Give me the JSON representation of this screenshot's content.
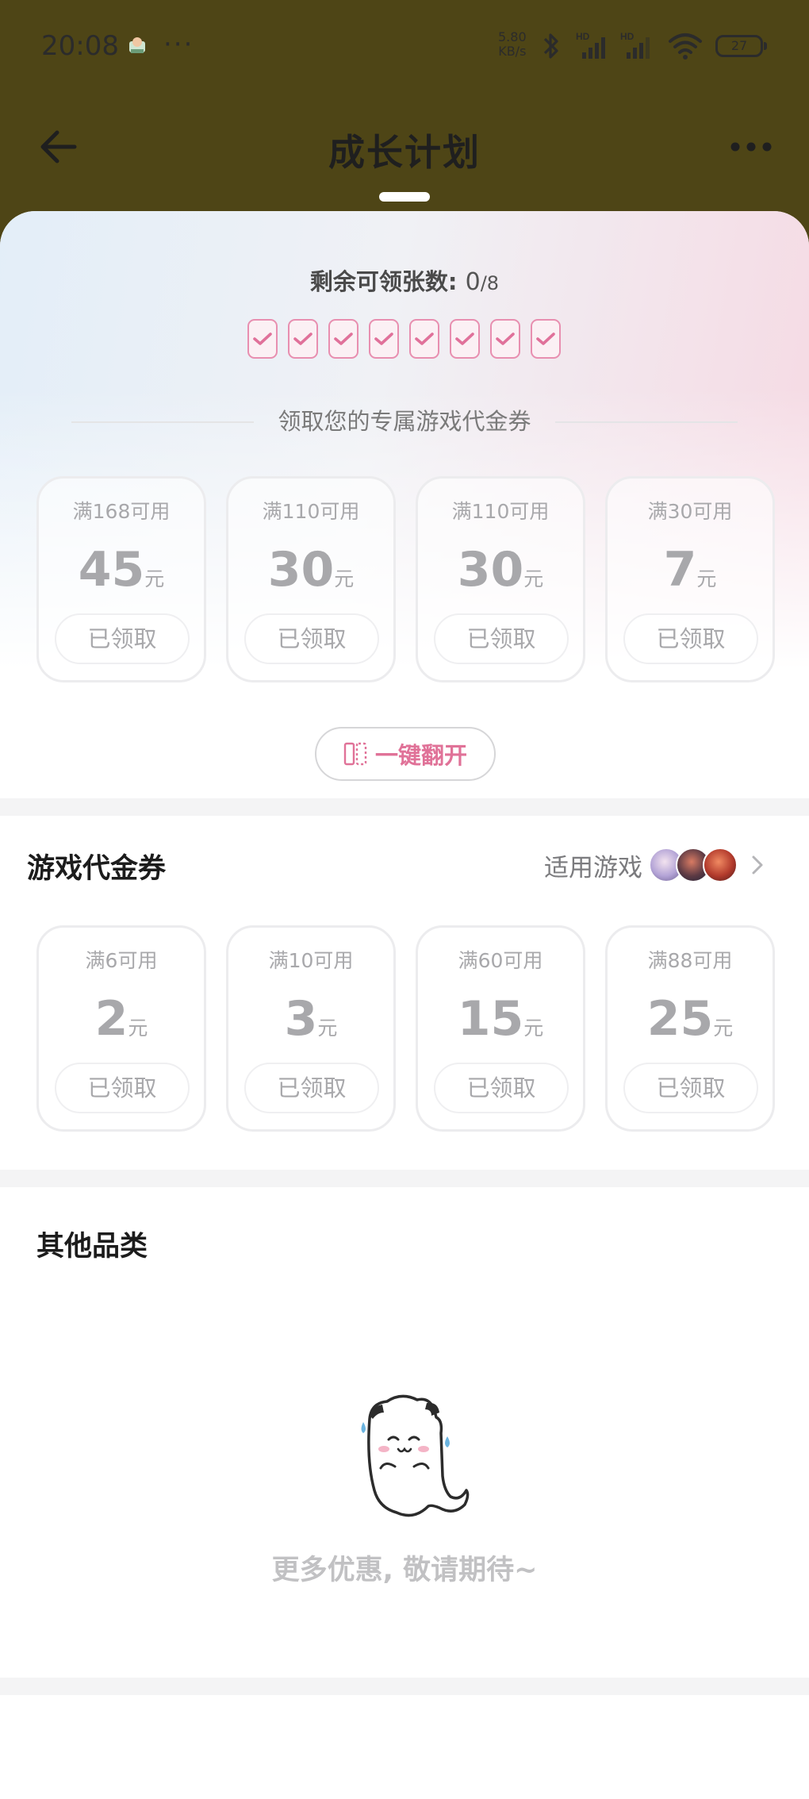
{
  "status_bar": {
    "time": "20:08",
    "more": "···",
    "net_speed_value": "5.80",
    "net_speed_unit": "KB/s",
    "battery": "27",
    "icons": [
      "notification-icon",
      "bluetooth-icon",
      "signal-hd-icon",
      "signal-hd-icon",
      "wifi-icon",
      "battery-icon"
    ]
  },
  "nav": {
    "title": "成长计划",
    "back_icon": "arrow-left-icon",
    "more_icon": "more-horizontal-icon"
  },
  "hero": {
    "remain_label": "剩余可领张数: ",
    "remain_claimed": "0",
    "remain_total": "/8",
    "ticks_checked": 8,
    "section_title": "领取您的专属游戏代金券",
    "coupons": [
      {
        "condition": "满168可用",
        "amount": "45",
        "unit": "元",
        "status": "已领取"
      },
      {
        "condition": "满110可用",
        "amount": "30",
        "unit": "元",
        "status": "已领取"
      },
      {
        "condition": "满110可用",
        "amount": "30",
        "unit": "元",
        "status": "已领取"
      },
      {
        "condition": "满30可用",
        "amount": "7",
        "unit": "元",
        "status": "已领取"
      }
    ],
    "flip_button": "一键翻开"
  },
  "game_vouchers": {
    "title": "游戏代金券",
    "games_link": "适用游戏",
    "coupons": [
      {
        "condition": "满6可用",
        "amount": "2",
        "unit": "元",
        "status": "已领取"
      },
      {
        "condition": "满10可用",
        "amount": "3",
        "unit": "元",
        "status": "已领取"
      },
      {
        "condition": "满60可用",
        "amount": "15",
        "unit": "元",
        "status": "已领取"
      },
      {
        "condition": "满88可用",
        "amount": "25",
        "unit": "元",
        "status": "已领取"
      }
    ]
  },
  "other": {
    "title": "其他品类",
    "empty_text": "更多优惠, 敬请期待~"
  },
  "colors": {
    "header_bg": "#4e4516",
    "accent_pink": "#e07298",
    "muted": "#a8a8ab"
  }
}
